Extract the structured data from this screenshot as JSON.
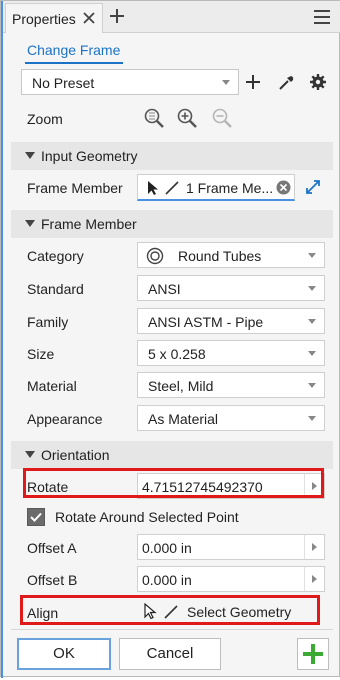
{
  "tab": {
    "label": "Properties"
  },
  "link": {
    "label": "Change Frame"
  },
  "preset": {
    "value": "No Preset"
  },
  "zoom": {
    "label": "Zoom"
  },
  "input_geometry": {
    "header": "Input Geometry",
    "frame_member_label": "Frame Member",
    "frame_member_value": "1 Frame Me..."
  },
  "frame_member": {
    "header": "Frame Member",
    "rows": [
      {
        "label": "Category",
        "value": "Round Tubes"
      },
      {
        "label": "Standard",
        "value": "ANSI"
      },
      {
        "label": "Family",
        "value": "ANSI ASTM - Pipe"
      },
      {
        "label": "Size",
        "value": "5 x 0.258"
      },
      {
        "label": "Material",
        "value": "Steel, Mild"
      },
      {
        "label": "Appearance",
        "value": "As Material"
      }
    ]
  },
  "orientation": {
    "header": "Orientation",
    "rotate_label": "Rotate",
    "rotate_value": "4.71512745492370",
    "rotate_around_label": "Rotate Around Selected Point",
    "rotate_around_checked": true,
    "offset_a_label": "Offset A",
    "offset_a_value": "0.000 in",
    "offset_b_label": "Offset B",
    "offset_b_value": "0.000 in",
    "align_label": "Align",
    "align_value": "Select Geometry"
  },
  "buttons": {
    "ok": "OK",
    "cancel": "Cancel"
  },
  "colors": {
    "accent": "#1a73c7",
    "highlight": "#e01a1a",
    "add_green": "#3aaa35"
  }
}
